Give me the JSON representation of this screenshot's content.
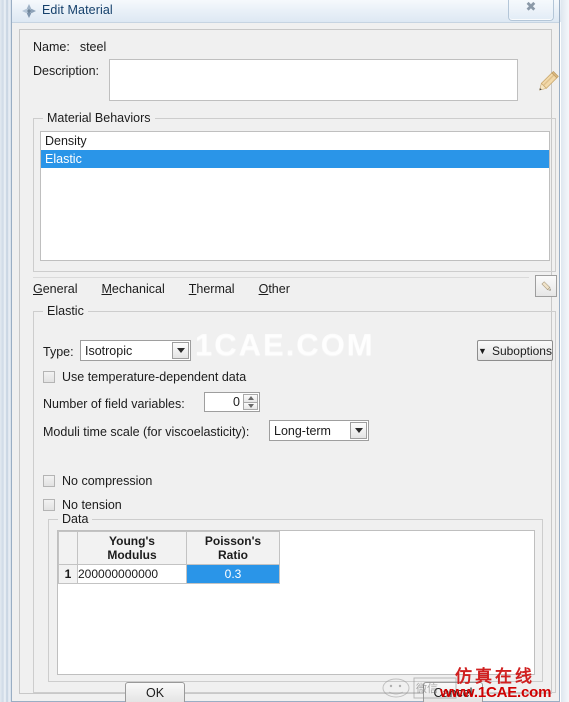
{
  "window": {
    "title": "Edit Material",
    "icon": "abaqus-diamond-icon",
    "close_label": "✕"
  },
  "form": {
    "name_label": "Name:",
    "name_value": "steel",
    "description_label": "Description:",
    "description_value": "",
    "description_placeholder": "",
    "edit_description_icon": "pencil-icon"
  },
  "material_behaviors": {
    "group_title": "Material Behaviors",
    "items": [
      {
        "label": "Density",
        "selected": false
      },
      {
        "label": "Elastic",
        "selected": true
      }
    ],
    "selected_color": "#2a95e8"
  },
  "menubar": {
    "items": [
      {
        "mnemonic": "G",
        "rest": "eneral"
      },
      {
        "mnemonic": "M",
        "rest": "echanical"
      },
      {
        "mnemonic": "T",
        "rest": "hermal"
      },
      {
        "mnemonic": "O",
        "rest": "ther"
      }
    ],
    "edit_button_icon": "pencil-icon"
  },
  "elastic": {
    "group_title": "Elastic",
    "type_label": "Type:",
    "type_value": "Isotropic",
    "suboptions_label": "Suboptions",
    "suboptions_arrow": "▼",
    "use_temp_dependent_label": "Use temperature-dependent data",
    "use_temp_dependent_checked": false,
    "num_field_vars_label": "Number of field variables:",
    "num_field_vars_value": "0",
    "moduli_label": "Moduli time scale (for viscoelasticity):",
    "moduli_value": "Long-term",
    "no_compression_label": "No compression",
    "no_compression_checked": false,
    "no_tension_label": "No tension",
    "no_tension_checked": false
  },
  "data": {
    "group_title": "Data",
    "columns": [
      "Young's\nModulus",
      "Poisson's\nRatio"
    ],
    "columns_line1": [
      "Young's",
      "Poisson's"
    ],
    "columns_line2": [
      "Modulus",
      "Ratio"
    ],
    "rows": [
      {
        "num": "1",
        "young_modulus": "200000000000",
        "poisson_ratio": "0.3"
      }
    ],
    "selected_cell": "poisson_ratio",
    "selected_color": "#2a95e8"
  },
  "buttons": {
    "ok": "OK",
    "cancel": "Cancel"
  },
  "watermarks": {
    "center": "1CAE.COM",
    "chinese": "仿真在线",
    "url": "www.1CAE.com",
    "url_color": "#d00000"
  }
}
